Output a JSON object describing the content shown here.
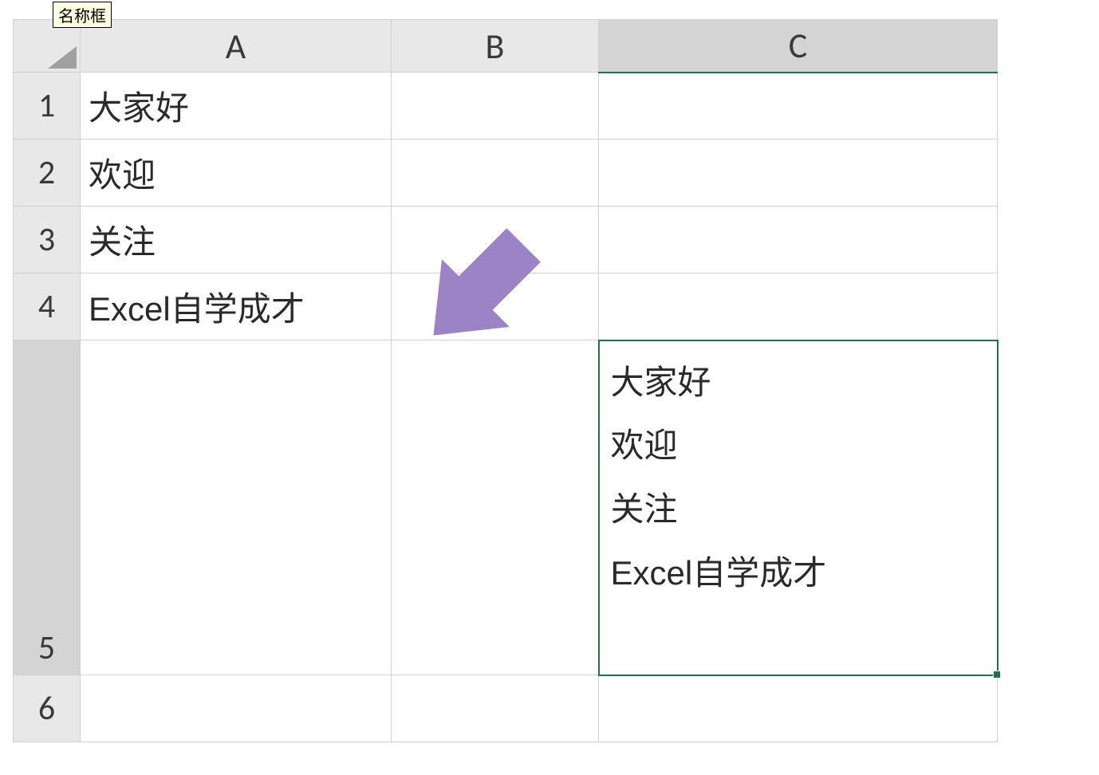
{
  "tooltip": "名称框",
  "columns": {
    "a": "A",
    "b": "B",
    "c": "C"
  },
  "rows": {
    "r1": "1",
    "r2": "2",
    "r3": "3",
    "r4": "4",
    "r5": "5",
    "r6": "6"
  },
  "cells": {
    "a1": "大家好",
    "a2": "欢迎",
    "a3": "关注",
    "a4": "Excel自学成才",
    "c5_line1": "大家好",
    "c5_line2": "欢迎",
    "c5_line3": "关注",
    "c5_line4": "Excel自学成才"
  },
  "arrow_color": "#9b83c6"
}
